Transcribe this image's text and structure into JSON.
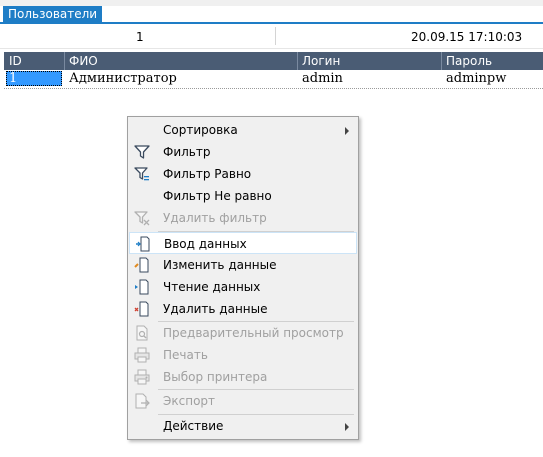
{
  "tab": {
    "label": "Пользователи"
  },
  "status": {
    "count": "1",
    "datetime": "20.09.15 17:10:03"
  },
  "grid": {
    "columns": [
      "ID",
      "ФИО",
      "Логин",
      "Пароль"
    ],
    "rows": [
      {
        "id": "1",
        "fio": "Администратор",
        "login": "admin",
        "password": "adminpw"
      }
    ]
  },
  "menu": {
    "items": [
      {
        "label": "Сортировка",
        "icon": "none",
        "submenu": true,
        "enabled": true
      },
      {
        "label": "Фильтр",
        "icon": "funnel-icon",
        "enabled": true
      },
      {
        "label": "Фильтр Равно",
        "icon": "funnel-equal-icon",
        "enabled": true
      },
      {
        "label": "Фильтр Не равно",
        "icon": "none",
        "enabled": true
      },
      {
        "label": "Удалить фильтр",
        "icon": "funnel-remove-icon",
        "enabled": false
      },
      {
        "label": "Ввод данных",
        "icon": "doc-add-icon",
        "enabled": true,
        "highlighted": true
      },
      {
        "label": "Изменить данные",
        "icon": "doc-edit-icon",
        "enabled": true
      },
      {
        "label": "Чтение данных",
        "icon": "doc-read-icon",
        "enabled": true
      },
      {
        "label": "Удалить данные",
        "icon": "doc-delete-icon",
        "enabled": true
      },
      {
        "label": "Предварительный просмотр",
        "icon": "preview-icon",
        "enabled": false
      },
      {
        "label": "Печать",
        "icon": "printer-icon",
        "enabled": false
      },
      {
        "label": "Выбор принтера",
        "icon": "printer-select-icon",
        "enabled": false
      },
      {
        "label": "Экспорт",
        "icon": "export-icon",
        "enabled": false
      },
      {
        "label": "Действие",
        "icon": "none",
        "submenu": true,
        "enabled": true
      }
    ]
  },
  "colors": {
    "tab_blue": "#1e7dc6",
    "header": "#4a5c74",
    "selection": "#3399ff"
  }
}
